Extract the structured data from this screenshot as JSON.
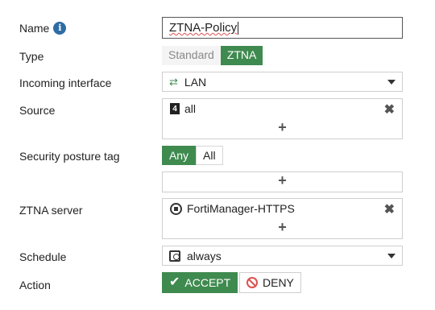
{
  "form": {
    "name": {
      "label": "Name",
      "value_underlined": "ZTNA-Policy"
    },
    "type": {
      "label": "Type",
      "options": [
        "Standard",
        "ZTNA"
      ],
      "selected": "ZTNA"
    },
    "incoming_interface": {
      "label": "Incoming interface",
      "value": "LAN",
      "icon": "swap-arrows-icon"
    },
    "source": {
      "label": "Source",
      "entries": [
        "all"
      ],
      "add_symbol": "+",
      "remove_symbol": "✖"
    },
    "security_posture_tag": {
      "label": "Security posture tag",
      "options": [
        "Any",
        "All"
      ],
      "selected": "Any",
      "add_symbol": "+"
    },
    "ztna_server": {
      "label": "ZTNA server",
      "entries": [
        "FortiManager-HTTPS"
      ],
      "add_symbol": "+",
      "remove_symbol": "✖"
    },
    "schedule": {
      "label": "Schedule",
      "value": "always"
    },
    "action": {
      "label": "Action",
      "accept_label": "ACCEPT",
      "deny_label": "DENY",
      "selected": "ACCEPT"
    }
  },
  "colors": {
    "accent_green": "#3f8a4f",
    "info_blue": "#2e6da4",
    "deny_red": "#d9534f"
  }
}
